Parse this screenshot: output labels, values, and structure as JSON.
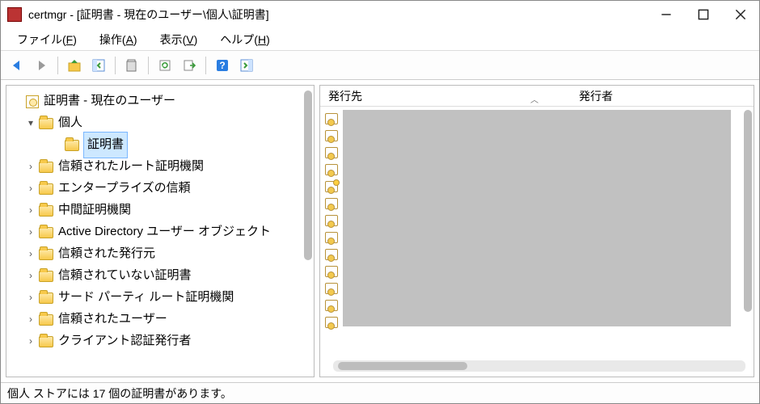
{
  "title": "certmgr - [証明書 - 現在のユーザー\\個人\\証明書]",
  "menu": {
    "file": "ファイル(<u>F</u>)",
    "action": "操作(<u>A</u>)",
    "view": "表示(<u>V</u>)",
    "help": "ヘルプ(<u>H</u>)"
  },
  "tree": {
    "root": "証明書 - 現在のユーザー",
    "items": [
      {
        "label": "個人",
        "expanded": true,
        "children": [
          {
            "label": "証明書",
            "selected": true
          }
        ]
      },
      {
        "label": "信頼されたルート証明機関"
      },
      {
        "label": "エンタープライズの信頼"
      },
      {
        "label": "中間証明機関"
      },
      {
        "label": "Active Directory ユーザー オブジェクト"
      },
      {
        "label": "信頼された発行元"
      },
      {
        "label": "信頼されていない証明書"
      },
      {
        "label": "サード パーティ ルート証明機関"
      },
      {
        "label": "信頼されたユーザー"
      },
      {
        "label": "クライアント認証発行者"
      }
    ]
  },
  "list": {
    "columns": {
      "issued_to": "発行先",
      "issuer": "発行者"
    },
    "row_count": 13,
    "key_row_index": 4
  },
  "status": "個人 ストアには 17 個の証明書があります。"
}
